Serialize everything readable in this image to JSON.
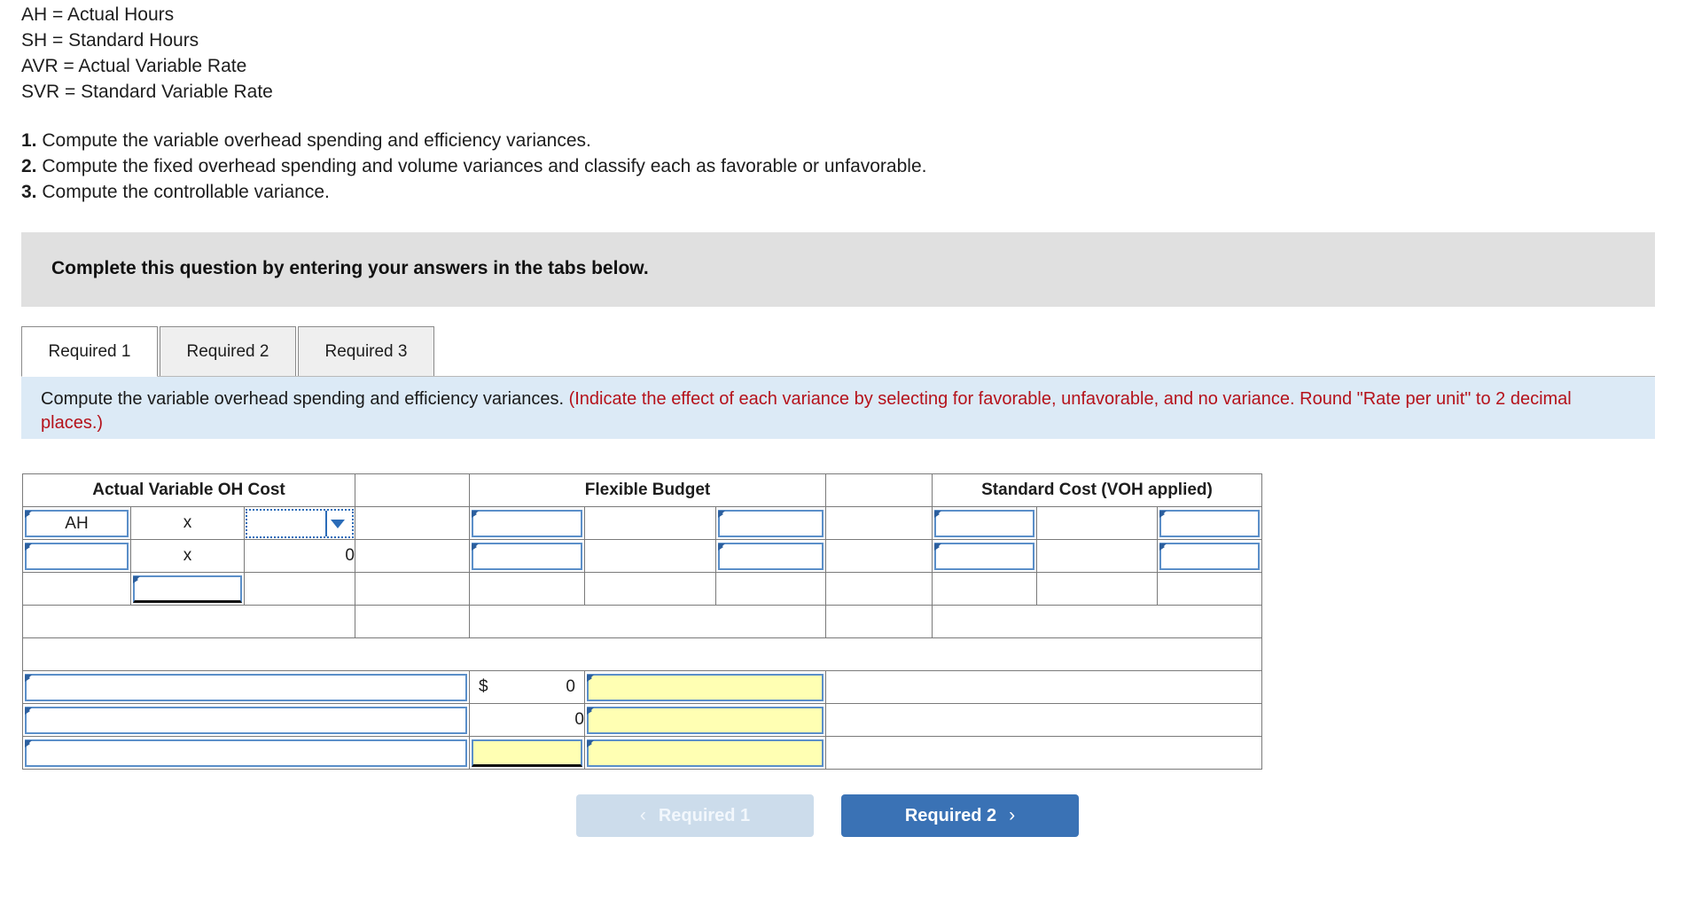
{
  "definitions": [
    "AH = Actual Hours",
    "SH = Standard Hours",
    "AVR = Actual Variable Rate",
    "SVR = Standard Variable Rate"
  ],
  "requirements": [
    {
      "num": "1.",
      "text": " Compute the variable overhead spending and efficiency variances."
    },
    {
      "num": "2.",
      "text": " Compute the fixed overhead spending and volume variances and classify each as favorable or unfavorable."
    },
    {
      "num": "3.",
      "text": " Compute the controllable variance."
    }
  ],
  "banner": {
    "text": "Complete this question by entering your answers in the tabs below."
  },
  "tabs": [
    {
      "label": "Required 1",
      "active": true
    },
    {
      "label": "Required 2",
      "active": false
    },
    {
      "label": "Required 3",
      "active": false
    }
  ],
  "instruction": {
    "black": "Compute the variable overhead spending and efficiency variances.",
    "red": "(Indicate the effect of each variance by selecting for favorable, unfavorable, and no variance. Round \"Rate per unit\" to 2 decimal places.)"
  },
  "worksheet": {
    "headers": {
      "actual": "Actual Variable OH Cost",
      "flexible": "Flexible Budget",
      "standard": "Standard Cost (VOH applied)"
    },
    "rows": {
      "r1": {
        "label": "AH",
        "op": "x",
        "dropdown_value": ""
      },
      "r2": {
        "label": "",
        "op": "x",
        "value": "0"
      },
      "r3": {
        "label": "",
        "value": ""
      }
    },
    "summary": {
      "row1_amount_symbol": "$",
      "row1_amount": "0",
      "row2_amount": "0",
      "row3_amount": ""
    }
  },
  "nav": {
    "prev_label": "Required 1",
    "next_label": "Required 2",
    "prev_chevron": "‹",
    "next_chevron": "›"
  },
  "colors": {
    "header_blue": "#7fb0e0",
    "input_border": "#5b8fc9",
    "yellow": "#ffffb3",
    "instruction_bg": "#dceaf6",
    "red_text": "#b5121b",
    "button_active": "#3a72b5",
    "button_disabled": "#ccdceb",
    "banner_bg": "#e0e0e0"
  }
}
